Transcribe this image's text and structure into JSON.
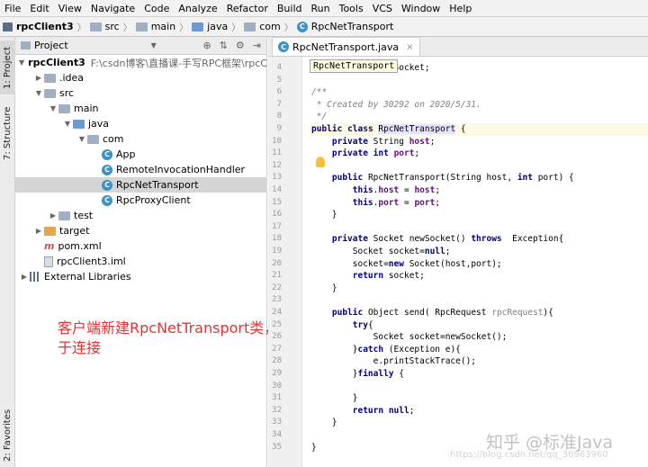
{
  "menubar": [
    "File",
    "Edit",
    "View",
    "Navigate",
    "Code",
    "Analyze",
    "Refactor",
    "Build",
    "Run",
    "Tools",
    "VCS",
    "Window",
    "Help"
  ],
  "breadcrumb": {
    "project": "rpcClient3",
    "items": [
      "src",
      "main",
      "java",
      "com"
    ],
    "file": "RpcNetTransport"
  },
  "sidestrip": {
    "project": "1: Project",
    "structure": "7: Structure",
    "favorites": "2: Favorites"
  },
  "project_panel": {
    "title": "Project",
    "tree": [
      {
        "label": "rpcClient3",
        "path": "F:\\csdn博客\\直播课-手写RPC框架\\rpcClie"
      },
      {
        "label": ".idea"
      },
      {
        "label": "src"
      },
      {
        "label": "main"
      },
      {
        "label": "java"
      },
      {
        "label": "com"
      },
      {
        "label": "App"
      },
      {
        "label": "RemoteInvocationHandler"
      },
      {
        "label": "RpcNetTransport"
      },
      {
        "label": "RpcProxyClient"
      },
      {
        "label": "test"
      },
      {
        "label": "target"
      },
      {
        "label": "pom.xml"
      },
      {
        "label": "rpcClient3.iml"
      },
      {
        "label": "External Libraries"
      }
    ]
  },
  "annotation": "客户端新建RpcNetTransport类，用于连接",
  "editor": {
    "tab_label": "RpcNetTransport.java",
    "tab_close": "×",
    "tooltip": "RpcNetTransport",
    "line_numbers": [
      "4",
      "5",
      "6",
      "7",
      "8",
      "9",
      "10",
      "11",
      "12",
      "13",
      "14",
      "15",
      "16",
      "17",
      "18",
      "19",
      "20",
      "21",
      "22",
      "23",
      "24",
      "25",
      "26",
      "27",
      "28",
      "29",
      "30",
      "31",
      "32",
      "33",
      "34",
      "35"
    ],
    "code": [
      "import java.net.Socket;",
      "",
      "/**",
      " * Created by 30292 on 2020/5/31.",
      " */",
      "public class RpcNetTransport {",
      "    private String host;",
      "    private int port;",
      "",
      "    public RpcNetTransport(String host, int port) {",
      "        this.host = host;",
      "        this.port = port;",
      "    }",
      "",
      "    private Socket newSocket() throws  Exception{",
      "        Socket socket=null;",
      "        socket=new Socket(host,port);",
      "        return socket;",
      "    }",
      "",
      "    public Object send( RpcRequest rpcRequest){",
      "        try{",
      "            Socket socket=newSocket();",
      "        }catch (Exception e){",
      "            e.printStackTrace();",
      "        }finally {",
      "",
      "        }",
      "        return null;",
      "    }",
      "",
      "}"
    ]
  },
  "watermark": "知乎 @标准Java",
  "watermark_url": "https://blog.csdn.net/qq_36963960"
}
